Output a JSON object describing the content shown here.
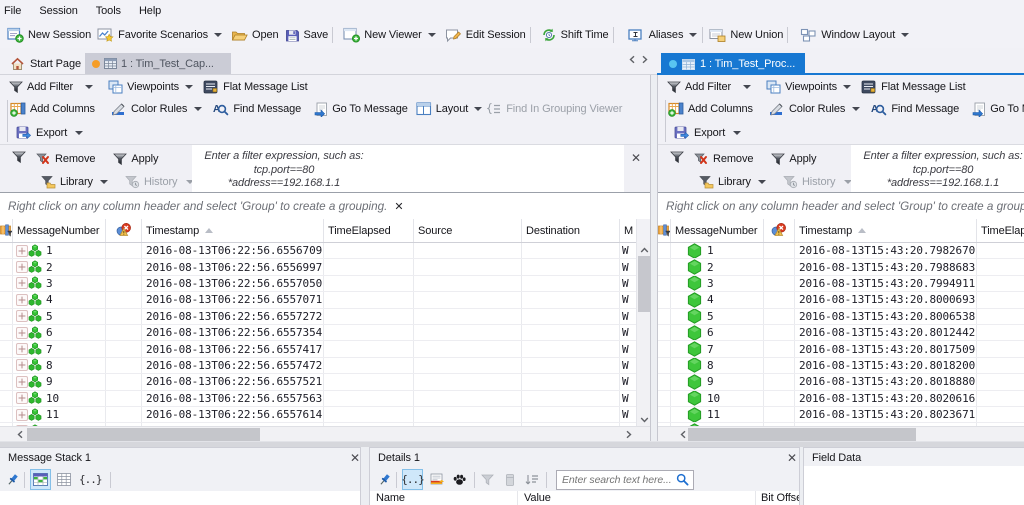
{
  "menu": {
    "items": [
      "File",
      "Session",
      "Tools",
      "Help"
    ]
  },
  "toolbar": {
    "new_session": "New Session",
    "favorite_scenarios": "Favorite Scenarios",
    "open": "Open",
    "save": "Save",
    "new_viewer": "New Viewer",
    "edit_session": "Edit Session",
    "shift_time": "Shift Time",
    "aliases": "Aliases",
    "new_union": "New Union",
    "window_layout": "Window Layout"
  },
  "tabs": {
    "start_page": "Start Page",
    "left_tab": "1 : Tim_Test_Cap...",
    "right_tab": "1 : Tim_Test_Proc...",
    "close_glyph": "✕"
  },
  "pane_labels": {
    "add_filter": "Add Filter",
    "viewpoints": "Viewpoints",
    "flat_message_list": "Flat Message List",
    "add_columns": "Add Columns",
    "color_rules": "Color Rules",
    "find_message": "Find Message",
    "go_to_message": "Go To Message",
    "layout": "Layout",
    "find_in_grouping_viewer": "Find In Grouping Viewer",
    "export": "Export",
    "remove": "Remove",
    "apply": "Apply",
    "library": "Library",
    "history": "History",
    "filter_hint_1": "Enter a filter expression, such as:",
    "filter_hint_2": "tcp.port==80",
    "filter_hint_3": "*address==192.168.1.1",
    "grouping_hint": "Right click on any column header and select 'Group' to create a grouping.",
    "grouping_close": "✕",
    "col_message_number": "MessageNumber",
    "col_timestamp": "Timestamp",
    "col_time_elapsed": "TimeElapsed",
    "col_source": "Source",
    "col_destination": "Destination",
    "col_m": "M",
    "cell_m": "W"
  },
  "panes": {
    "left": {
      "rows": [
        {
          "n": "1",
          "ts": "2016-08-13T06:22:56.6556709"
        },
        {
          "n": "2",
          "ts": "2016-08-13T06:22:56.6556997"
        },
        {
          "n": "3",
          "ts": "2016-08-13T06:22:56.6557050"
        },
        {
          "n": "4",
          "ts": "2016-08-13T06:22:56.6557071"
        },
        {
          "n": "5",
          "ts": "2016-08-13T06:22:56.6557272"
        },
        {
          "n": "6",
          "ts": "2016-08-13T06:22:56.6557354"
        },
        {
          "n": "7",
          "ts": "2016-08-13T06:22:56.6557417"
        },
        {
          "n": "8",
          "ts": "2016-08-13T06:22:56.6557472"
        },
        {
          "n": "9",
          "ts": "2016-08-13T06:22:56.6557521"
        },
        {
          "n": "10",
          "ts": "2016-08-13T06:22:56.6557563"
        },
        {
          "n": "11",
          "ts": "2016-08-13T06:22:56.6557614"
        }
      ],
      "partial_row_visible": true
    },
    "right": {
      "rows": [
        {
          "n": "1",
          "ts": "2016-08-13T15:43:20.7982670"
        },
        {
          "n": "2",
          "ts": "2016-08-13T15:43:20.7988683"
        },
        {
          "n": "3",
          "ts": "2016-08-13T15:43:20.7994911"
        },
        {
          "n": "4",
          "ts": "2016-08-13T15:43:20.8000693"
        },
        {
          "n": "5",
          "ts": "2016-08-13T15:43:20.8006538"
        },
        {
          "n": "6",
          "ts": "2016-08-13T15:43:20.8012442"
        },
        {
          "n": "7",
          "ts": "2016-08-13T15:43:20.8017509"
        },
        {
          "n": "8",
          "ts": "2016-08-13T15:43:20.8018200"
        },
        {
          "n": "9",
          "ts": "2016-08-13T15:43:20.8018880"
        },
        {
          "n": "10",
          "ts": "2016-08-13T15:43:20.8020616"
        },
        {
          "n": "11",
          "ts": "2016-08-13T15:43:20.8023671"
        }
      ],
      "partial_row_visible": true
    }
  },
  "bottom": {
    "message_stack": {
      "title": "Message Stack 1"
    },
    "details": {
      "title": "Details 1",
      "search_placeholder": "Enter search text here...",
      "col_name": "Name",
      "col_value": "Value",
      "col_bit_offset": "Bit Offset"
    },
    "field_data": {
      "title": "Field Data"
    }
  },
  "colors": {
    "accent_blue": "#1778d2",
    "active_tab": "#1778d2",
    "inactive_tab": "#cbccd6",
    "row_icon_green": "#3ec63b",
    "tab_dot_left": "#f59d27",
    "tab_dot_right": "#59c5f1"
  }
}
